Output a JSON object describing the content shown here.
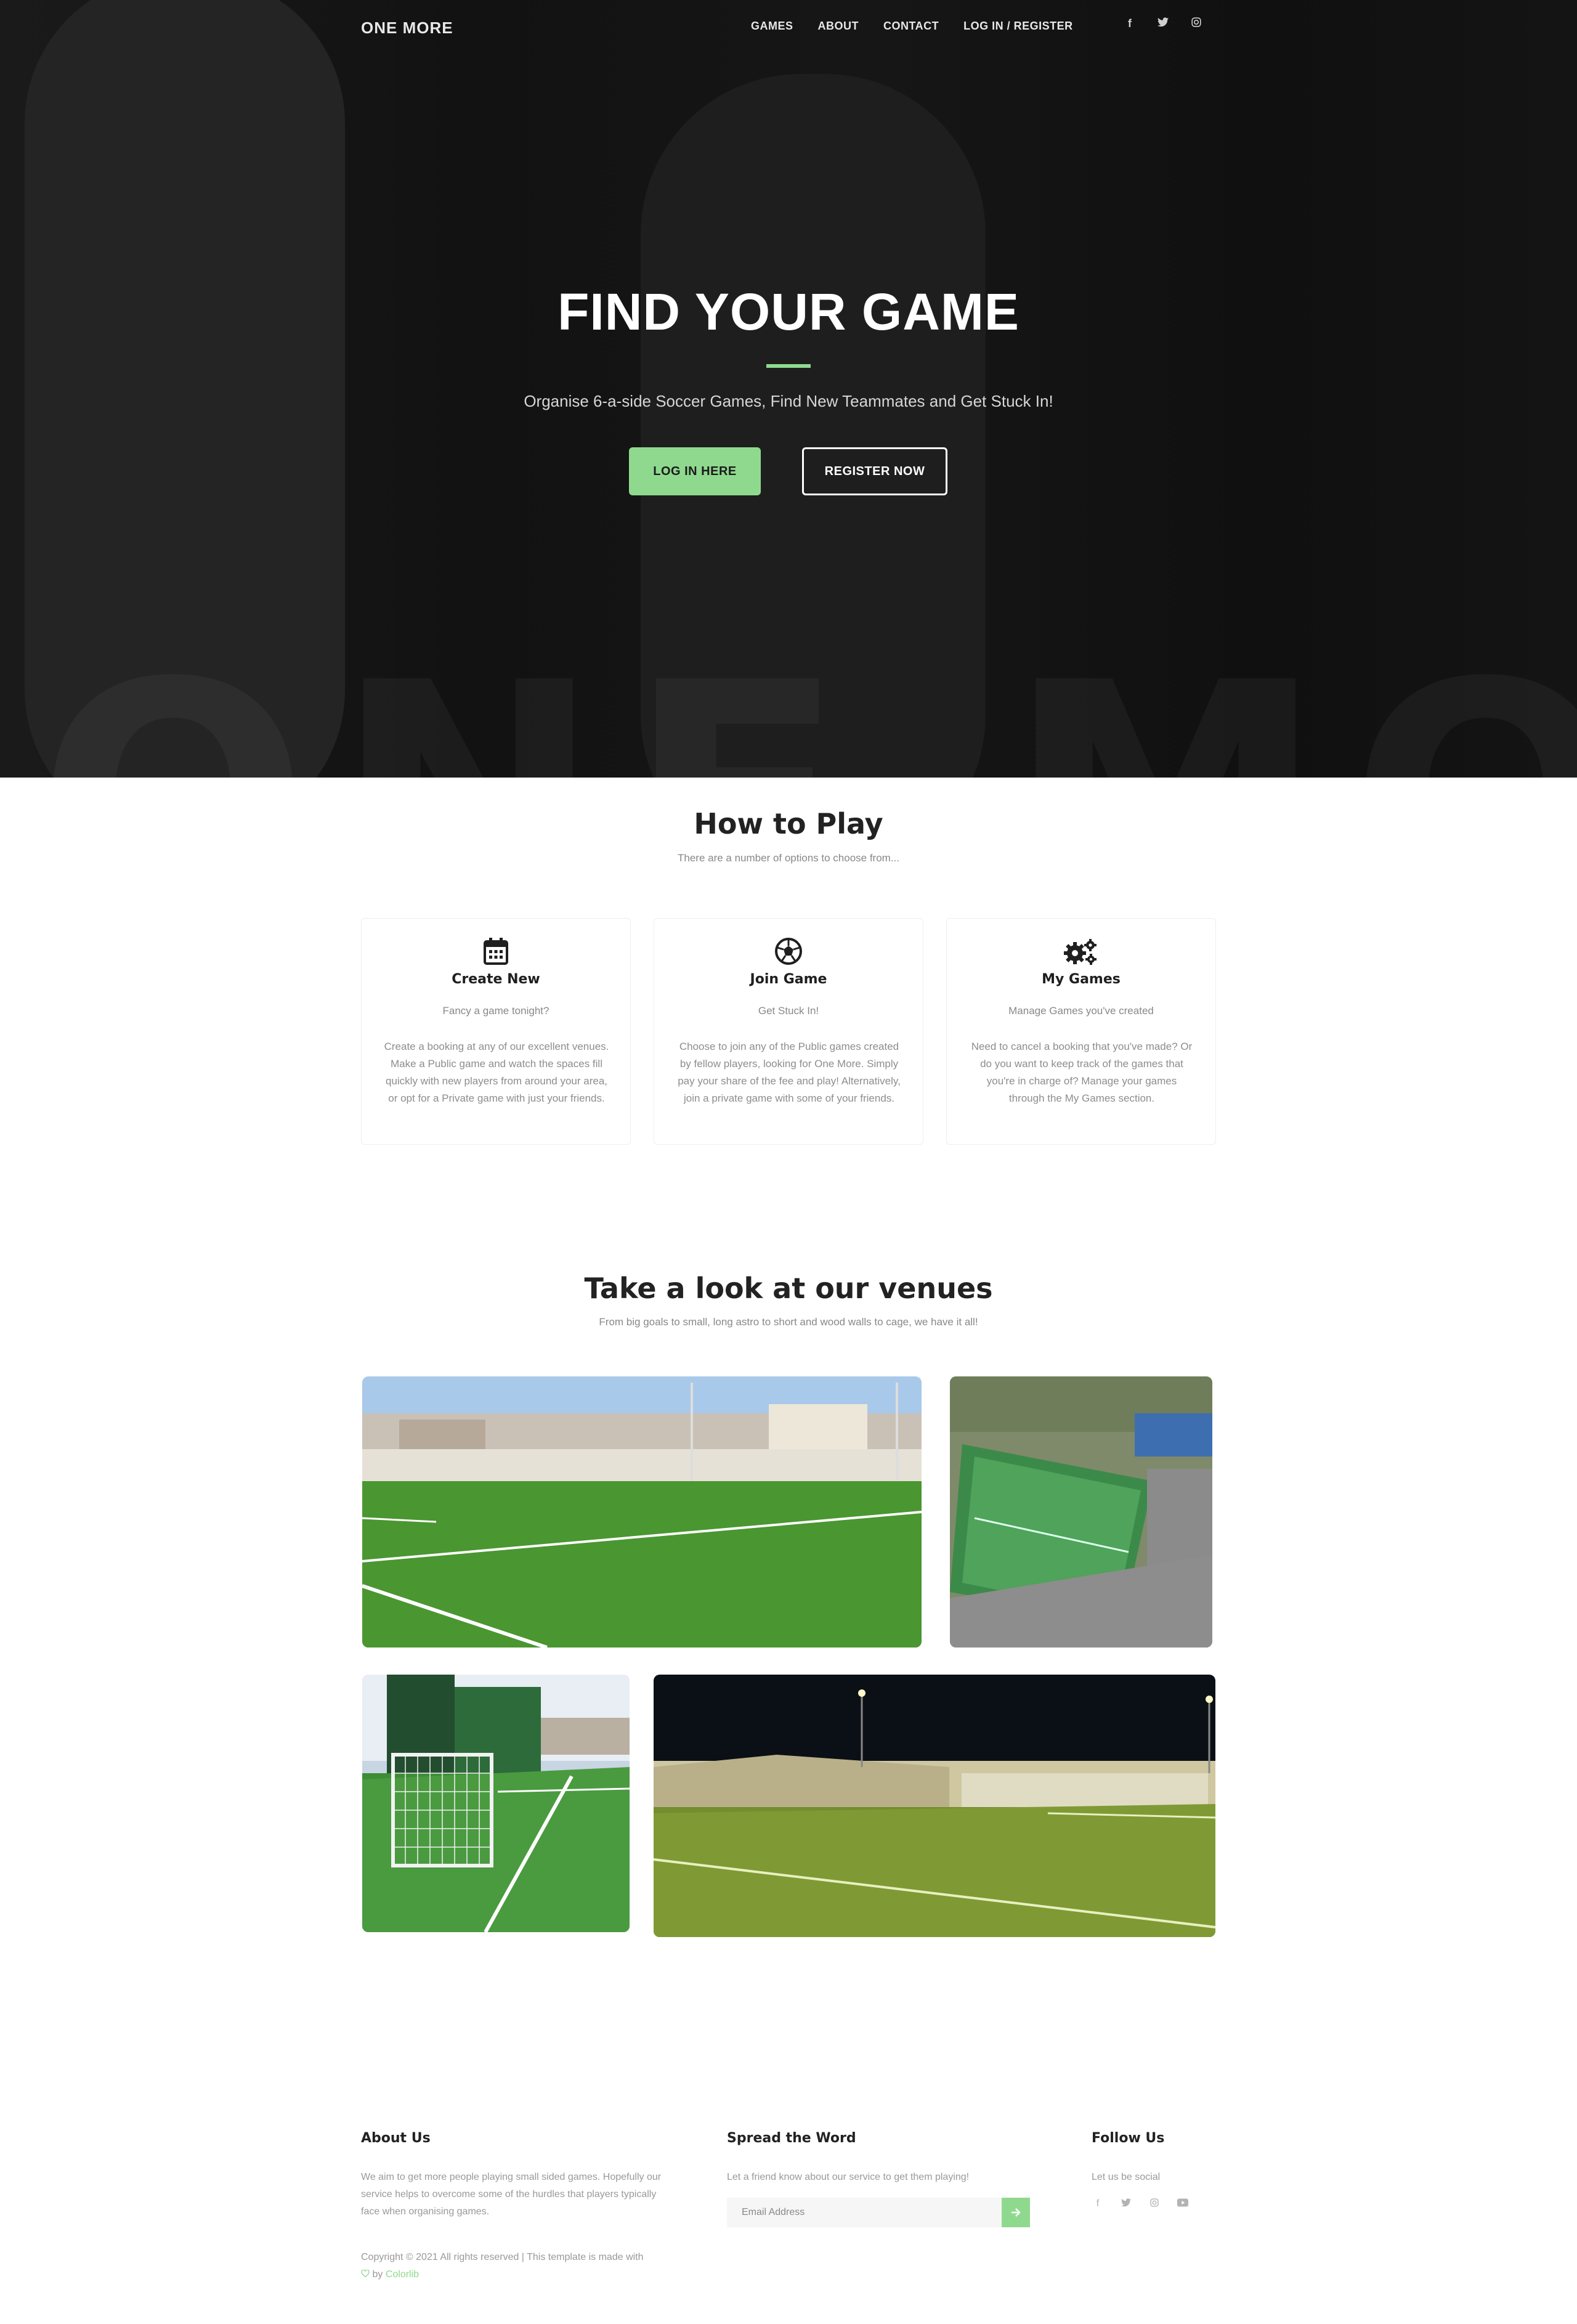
{
  "nav": {
    "brand": "ONE MORE",
    "links": [
      "GAMES",
      "ABOUT",
      "CONTACT",
      "LOG IN / REGISTER"
    ],
    "social_icons": [
      "facebook-icon",
      "twitter-icon",
      "instagram-icon"
    ]
  },
  "hero": {
    "title": "FIND YOUR GAME",
    "subtitle": "Organise 6-a-side Soccer Games, Find New Teammates and Get Stuck In!",
    "login_button": "LOG IN HERE",
    "register_button": "REGISTER NOW",
    "watermark": "ONE MORE"
  },
  "how_to_play": {
    "title": "How to Play",
    "subtitle": "There are a number of options to choose from...",
    "cards": [
      {
        "icon": "calendar-icon",
        "title": "Create New",
        "tag": "Fancy a game tonight?",
        "body": "Create a booking at any of our excellent venues. Make a Public game and watch the spaces fill quickly with new players from around your area, or opt for a Private game with just your friends."
      },
      {
        "icon": "football-icon",
        "title": "Join Game",
        "tag": "Get Stuck In!",
        "body": "Choose to join any of the Public games created by fellow players, looking for One More. Simply pay your share of the fee and play! Alternatively, join a private game with some of your friends."
      },
      {
        "icon": "gears-icon",
        "title": "My Games",
        "tag": "Manage Games you've created",
        "body": "Need to cancel a booking that you've made? Or do you want to keep track of the games that you're in charge of? Manage your games through the My Games section."
      }
    ]
  },
  "venues": {
    "title": "Take a look at our venues",
    "subtitle": "From big goals to small, long astro to short and wood walls to cage, we have it all!"
  },
  "footer": {
    "about": {
      "title": "About Us",
      "text": "We aim to get more people playing small sided games. Hopefully our service helps to overcome some of the hurdles that players typically face when organising games."
    },
    "spread": {
      "title": "Spread the Word",
      "text": "Let a friend know about our service to get them playing!",
      "email_placeholder": "Email Address"
    },
    "follow": {
      "title": "Follow Us",
      "text": "Let us be social",
      "icons": [
        "facebook-icon",
        "twitter-icon",
        "instagram-icon",
        "youtube-icon"
      ]
    },
    "copyright": "Copyright © 2021 All rights reserved | This template is made with",
    "by": "by",
    "credit": "Colorlib"
  },
  "colors": {
    "accent": "#8fd98f",
    "hero_bg": "#141414"
  }
}
